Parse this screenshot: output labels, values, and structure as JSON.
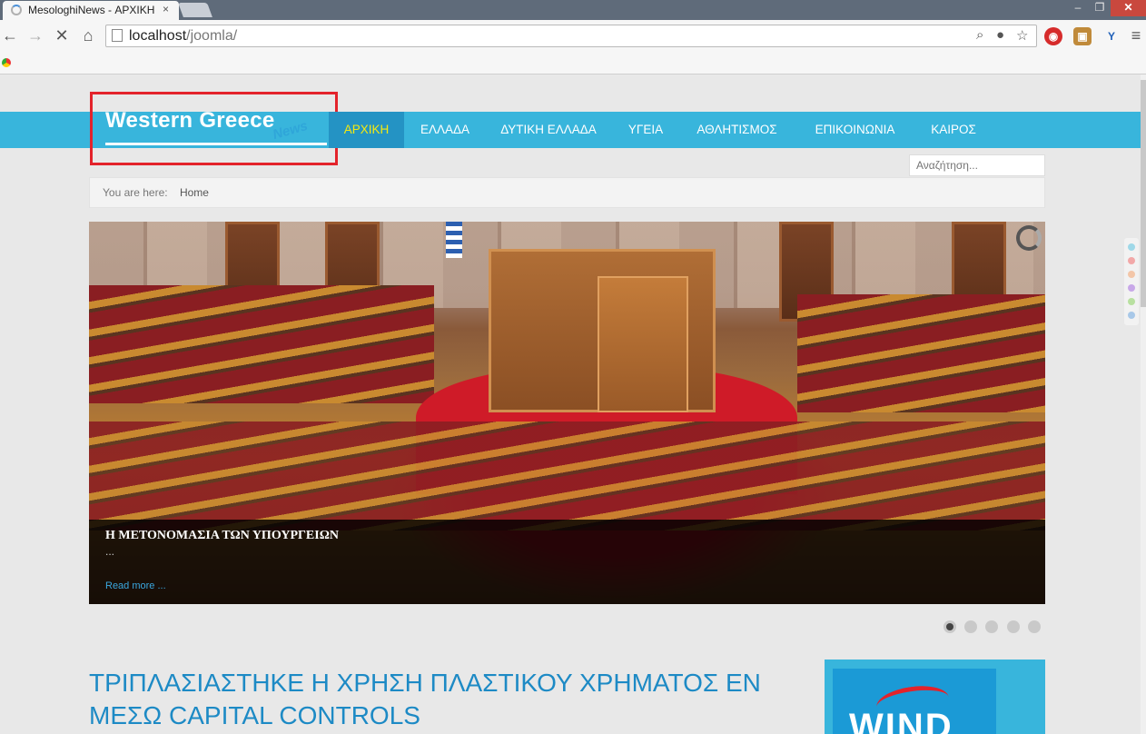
{
  "browser": {
    "tab_title": "MesologhiNews - ΑΡΧΙΚΗ",
    "url_host": "localhost",
    "url_path": "/joomla/",
    "close_glyph": "×",
    "window_controls": {
      "minimize": "–",
      "maximize": "❐",
      "close": "✕"
    }
  },
  "site": {
    "logo_title": "Western Greece",
    "logo_sub": "News",
    "nav": [
      "ΑΡΧΙΚΗ",
      "ΕΛΛΑΔΑ",
      "ΔΥΤΙΚΗ ΕΛΛΑΔΑ",
      "ΥΓΕΙΑ",
      "ΑΘΛΗΤΙΣΜΟΣ",
      "ΕΠΙΚΟΙΝΩΝΙΑ",
      "ΚΑΙΡΟΣ"
    ],
    "active_nav": "ΑΡΧΙΚΗ",
    "search_placeholder": "Αναζήτηση...",
    "breadcrumb": {
      "label": "You are here:",
      "item": "Home"
    }
  },
  "slider": {
    "caption_title": "Η ΜΕΤΟΝΟΜΑΣΙΑ ΤΩΝ ΥΠΟΥΡΓΕΙΩΝ",
    "caption_desc": "...",
    "read_more": "Read more ...",
    "slide_count": 5,
    "active_slide": 1
  },
  "article": {
    "title": "ΤΡΙΠΛΑΣΙΑΣΤΗΚΕ Η ΧΡΗΣΗ ΠΛΑΣΤΙΚΟΥ ΧΡΗΜΑΤΟΣ ΕΝ ΜΕΣΩ CAPITAL CONTROLS"
  },
  "ad": {
    "brand": "WIND"
  },
  "colors": {
    "nav_bg": "#38b5dc",
    "nav_active_bg": "#2493c4",
    "nav_active_text": "#f6e90f",
    "highlight_border": "#e3232b",
    "article_title": "#1d8ac5"
  }
}
